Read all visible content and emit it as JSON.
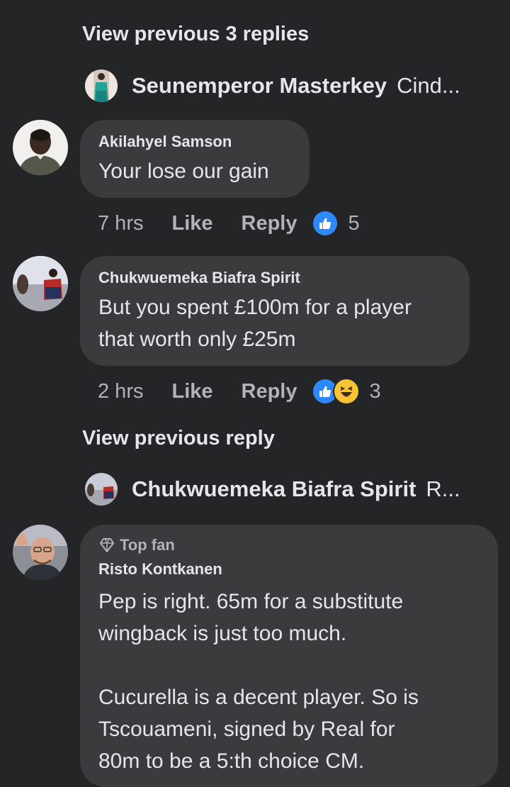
{
  "thread1": {
    "view_previous": "View previous 3 replies",
    "collapsed": {
      "name": "Seunemperor Masterkey",
      "snippet": "Cind..."
    }
  },
  "comments": [
    {
      "author": "Akilahyel Samson",
      "text": "Your lose our gain",
      "time": "7 hrs",
      "like": "Like",
      "reply": "Reply",
      "reactions": [
        "like"
      ],
      "reaction_count": "5"
    },
    {
      "author": "Chukwuemeka Biafra Spirit",
      "text": "But you spent £100m for a player\nthat worth only £25m",
      "time": "2 hrs",
      "like": "Like",
      "reply": "Reply",
      "reactions": [
        "like",
        "haha"
      ],
      "reaction_count": "3"
    },
    {
      "badge": "Top fan",
      "author": "Risto Kontkanen",
      "text": "Pep is right. 65m for a substitute\nwingback is just too much.\n\nCucurella is a decent player. So is\nTscouameni, signed by Real for\n80m to be a 5:th choice CM."
    }
  ],
  "thread2": {
    "view_previous": "View previous reply",
    "collapsed": {
      "name": "Chukwuemeka Biafra Spirit",
      "snippet": "R..."
    }
  },
  "colors": {
    "background": "#242526",
    "bubble": "#3a3b3c",
    "primary_text": "#e4e6eb",
    "secondary_text": "#b0b3b8",
    "like_blue": "#2e89ff",
    "haha_yellow": "#f7c436"
  },
  "icons": {
    "like": "thumbs-up-icon",
    "haha": "laughing-face-icon",
    "top_fan": "diamond-icon"
  }
}
